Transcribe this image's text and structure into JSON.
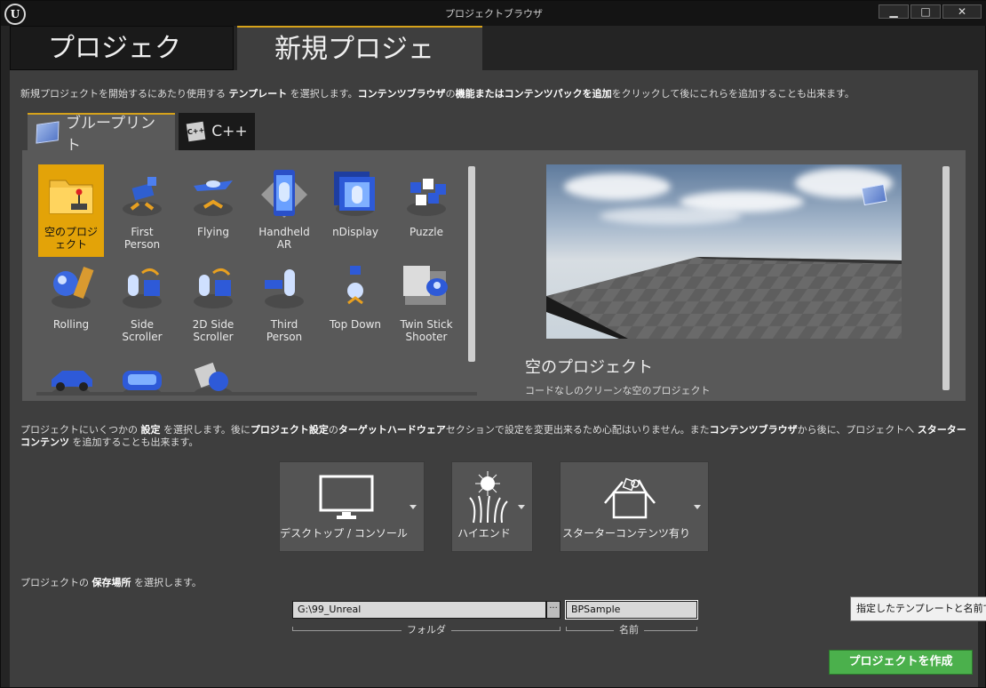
{
  "window": {
    "title": "プロジェクトブラウザ",
    "logo_text": "U",
    "controls": {
      "minimize": "▁",
      "maximize": "□",
      "close": "✕"
    }
  },
  "main_tabs": [
    {
      "label": "プロジェクト",
      "active": false
    },
    {
      "label": "新規プロジェクト",
      "active": true
    }
  ],
  "intro": {
    "p1": "新規プロジェクトを開始するにあたり使用する ",
    "b1": "テンプレート",
    "p2": " を選択します。",
    "b2": "コンテンツブラウザ",
    "p3": "の",
    "b3": "機能またはコンテンツパックを追加",
    "p4": "をクリックして後にこれらを追加することも出来ます。"
  },
  "sub_tabs": [
    {
      "label": "ブループリント",
      "icon": "blueprint-icon",
      "active": true
    },
    {
      "label": "C++",
      "icon": "cpp-icon",
      "icon_text": "C++",
      "active": false
    }
  ],
  "templates": [
    {
      "label1": "空のプロジ",
      "label2": "ェクト",
      "icon": "folder-joystick-icon",
      "selected": true
    },
    {
      "label1": "First",
      "label2": "Person",
      "icon": "first-person-icon"
    },
    {
      "label1": "Flying",
      "label2": "",
      "icon": "flying-icon"
    },
    {
      "label1": "Handheld",
      "label2": "AR",
      "icon": "handheld-ar-icon"
    },
    {
      "label1": "nDisplay",
      "label2": "",
      "icon": "ndisplay-icon"
    },
    {
      "label1": "Puzzle",
      "label2": "",
      "icon": "puzzle-icon"
    },
    {
      "label1": "Rolling",
      "label2": "",
      "icon": "rolling-icon"
    },
    {
      "label1": "Side",
      "label2": "Scroller",
      "icon": "side-scroller-icon"
    },
    {
      "label1": "2D Side",
      "label2": "Scroller",
      "icon": "2d-side-scroller-icon"
    },
    {
      "label1": "Third",
      "label2": "Person",
      "icon": "third-person-icon"
    },
    {
      "label1": "Top Down",
      "label2": "",
      "icon": "top-down-icon"
    },
    {
      "label1": "Twin Stick",
      "label2": "Shooter",
      "icon": "twin-stick-shooter-icon"
    },
    {
      "label1": "",
      "label2": "",
      "icon": "vehicle-icon"
    },
    {
      "label1": "",
      "label2": "",
      "icon": "vr-icon"
    },
    {
      "label1": "",
      "label2": "",
      "icon": "robot-icon"
    }
  ],
  "preview": {
    "title": "空のプロジェクト",
    "description": "コードなしのクリーンな空のプロジェクト"
  },
  "settings_text": {
    "p1": "プロジェクトにいくつかの ",
    "b1": "設定",
    "p2": " を選択します。後に",
    "b2": "プロジェクト設定",
    "p3": "の",
    "b3": "ターゲットハードウェア",
    "p4": "セクションで設定を変更出来るため心配はいりません。また",
    "b4": "コンテンツブラウザ",
    "p5": "から後に、プロジェクトへ ",
    "b5": "スターターコンテンツ",
    "p6": " を追加することも出来ます。"
  },
  "settings": [
    {
      "label": "デスクトップ / コンソール",
      "icon": "monitor-icon"
    },
    {
      "label": "ハイエンド",
      "icon": "high-end-icon"
    },
    {
      "label": "スターターコンテンツ有り",
      "icon": "starter-content-box-icon"
    }
  ],
  "location": {
    "p1": "プロジェクトの ",
    "b1": "保存場所",
    "p2": " を選択します。",
    "folder_value": "G:\\99_Unreal",
    "browse_label": "···",
    "name_value": "BPSample",
    "folder_caption": "フォルダ",
    "name_caption": "名前"
  },
  "create_button": "プロジェクトを作成",
  "tooltip": "指定したテンプレートと名前でプ"
}
